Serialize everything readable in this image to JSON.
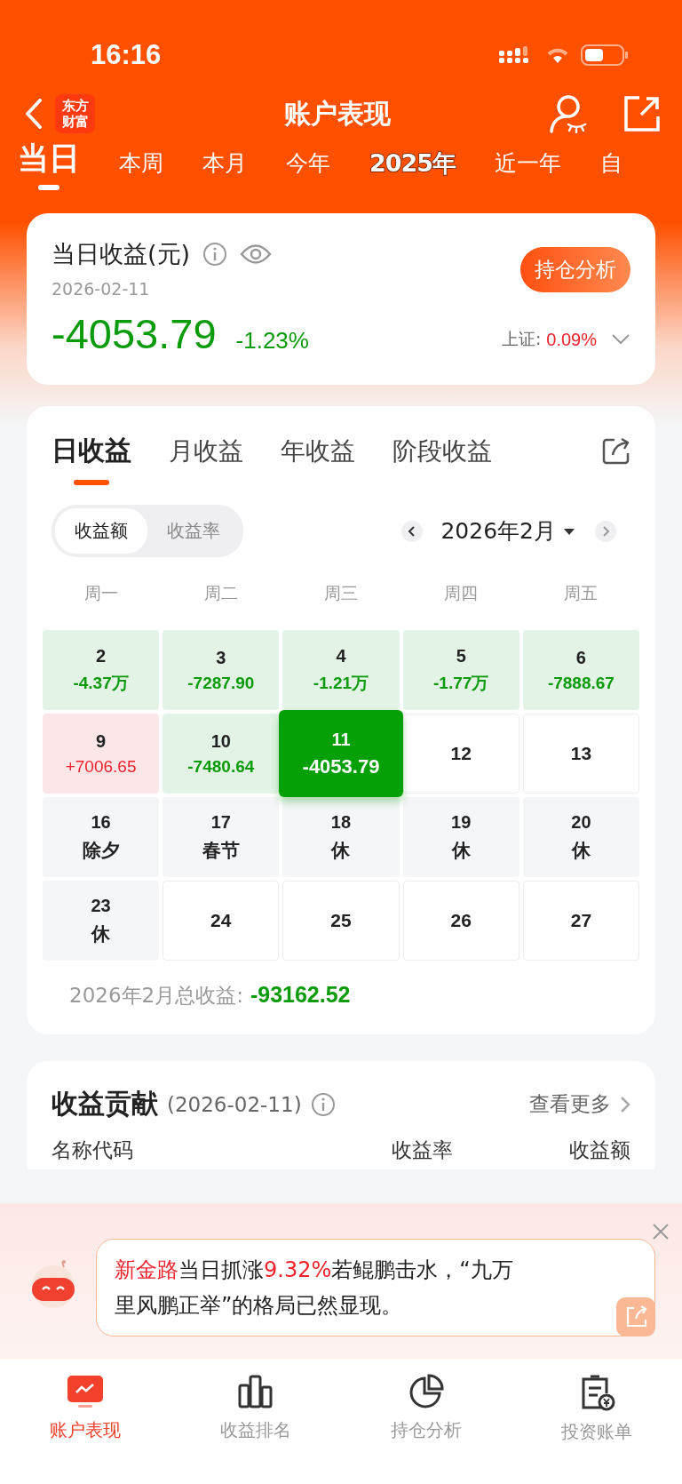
{
  "status_bar": {
    "time": "16:16"
  },
  "nav": {
    "logo": [
      "东方",
      "财富"
    ],
    "title": "账户表现"
  },
  "period_tabs": [
    {
      "label": "当日",
      "selected": true,
      "kind": "plain"
    },
    {
      "label": "本周",
      "selected": false,
      "kind": "plain"
    },
    {
      "label": "本月",
      "selected": false,
      "kind": "plain"
    },
    {
      "label": "今年",
      "selected": false,
      "kind": "plain"
    },
    {
      "label": "2025年",
      "selected": false,
      "kind": "special"
    },
    {
      "label": "近一年",
      "selected": false,
      "kind": "plain"
    },
    {
      "label": "自",
      "selected": false,
      "kind": "plain"
    }
  ],
  "summary": {
    "title": "当日收益(元)",
    "date": "2026-02-11",
    "amount": "-4053.79",
    "percent": "-1.23%",
    "button": "持仓分析",
    "index_label": "上证:",
    "index_value": "0.09%"
  },
  "profit_tabs": [
    {
      "label": "日收益",
      "selected": true
    },
    {
      "label": "月收益",
      "selected": false
    },
    {
      "label": "年收益",
      "selected": false
    },
    {
      "label": "阶段收益",
      "selected": false
    }
  ],
  "mode_toggle": [
    {
      "label": "收益额",
      "selected": true
    },
    {
      "label": "收益率",
      "selected": false
    }
  ],
  "month": {
    "label": "2026年2月"
  },
  "weekdays": [
    "周一",
    "周二",
    "周三",
    "周四",
    "周五"
  ],
  "calendar_rows": [
    [
      {
        "day": "2",
        "sub": "-4.37万",
        "kind": "loss"
      },
      {
        "day": "3",
        "sub": "-7287.90",
        "kind": "loss"
      },
      {
        "day": "4",
        "sub": "-1.21万",
        "kind": "loss"
      },
      {
        "day": "5",
        "sub": "-1.77万",
        "kind": "loss"
      },
      {
        "day": "6",
        "sub": "-7888.67",
        "kind": "loss"
      }
    ],
    [
      {
        "day": "9",
        "sub": "+7006.65",
        "kind": "gain"
      },
      {
        "day": "10",
        "sub": "-7480.64",
        "kind": "loss"
      },
      {
        "day": "11",
        "sub": "-4053.79",
        "kind": "selected"
      },
      {
        "day": "12",
        "kind": "future"
      },
      {
        "day": "13",
        "kind": "future"
      }
    ],
    [
      {
        "day": "16",
        "sub": "除夕",
        "kind": "holiday"
      },
      {
        "day": "17",
        "sub": "春节",
        "kind": "holiday"
      },
      {
        "day": "18",
        "sub": "休",
        "kind": "holiday"
      },
      {
        "day": "19",
        "sub": "休",
        "kind": "holiday"
      },
      {
        "day": "20",
        "sub": "休",
        "kind": "holiday"
      }
    ],
    [
      {
        "day": "23",
        "sub": "休",
        "kind": "holiday"
      },
      {
        "day": "24",
        "kind": "future"
      },
      {
        "day": "25",
        "kind": "future"
      },
      {
        "day": "26",
        "kind": "future"
      },
      {
        "day": "27",
        "kind": "future"
      }
    ]
  ],
  "total": {
    "label": "2026年2月总收益:",
    "value": "-93162.52"
  },
  "contribution": {
    "title": "收益贡献",
    "date": "(2026-02-11)",
    "more": "查看更多",
    "columns": [
      "名称代码",
      "收益率",
      "收益额"
    ]
  },
  "ai_tip": {
    "segments": [
      {
        "text": "新金路",
        "highlight": true
      },
      {
        "text": "当日抓涨",
        "highlight": false
      },
      {
        "text": "9.32%",
        "highlight": true
      },
      {
        "text": "若鲲鹏击水，“九万里风鹏正举”的格局已然显现。",
        "highlight": false
      }
    ]
  },
  "bottom_nav": [
    {
      "label": "账户表现",
      "selected": true,
      "kind": "chart"
    },
    {
      "label": "收益排名",
      "selected": false,
      "kind": "bars"
    },
    {
      "label": "持仓分析",
      "selected": false,
      "kind": "pie"
    },
    {
      "label": "投资账单",
      "selected": false,
      "kind": "bill"
    }
  ]
}
